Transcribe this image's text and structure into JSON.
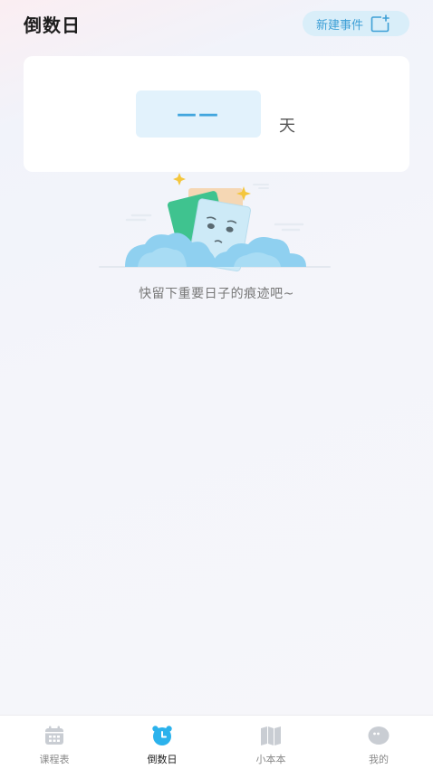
{
  "header": {
    "title": "倒数日",
    "new_event_label": "新建事件"
  },
  "countdown": {
    "value": "——",
    "unit": "天"
  },
  "empty_state": {
    "hint": "快留下重要日子的痕迹吧~"
  },
  "tabbar": {
    "items": [
      {
        "label": "课程表",
        "icon": "calendar-icon",
        "active": false
      },
      {
        "label": "倒数日",
        "icon": "alarm-clock-icon",
        "active": true
      },
      {
        "label": "小本本",
        "icon": "book-icon",
        "active": false
      },
      {
        "label": "我的",
        "icon": "face-icon",
        "active": false
      }
    ]
  },
  "colors": {
    "accent": "#2bb2ec",
    "accent_text": "#3d9fd6",
    "button_bg": "#d9eef9",
    "count_bg": "#e2f2fc",
    "inactive_icon": "#c9cdd3",
    "card_bg": "#ffffff"
  }
}
